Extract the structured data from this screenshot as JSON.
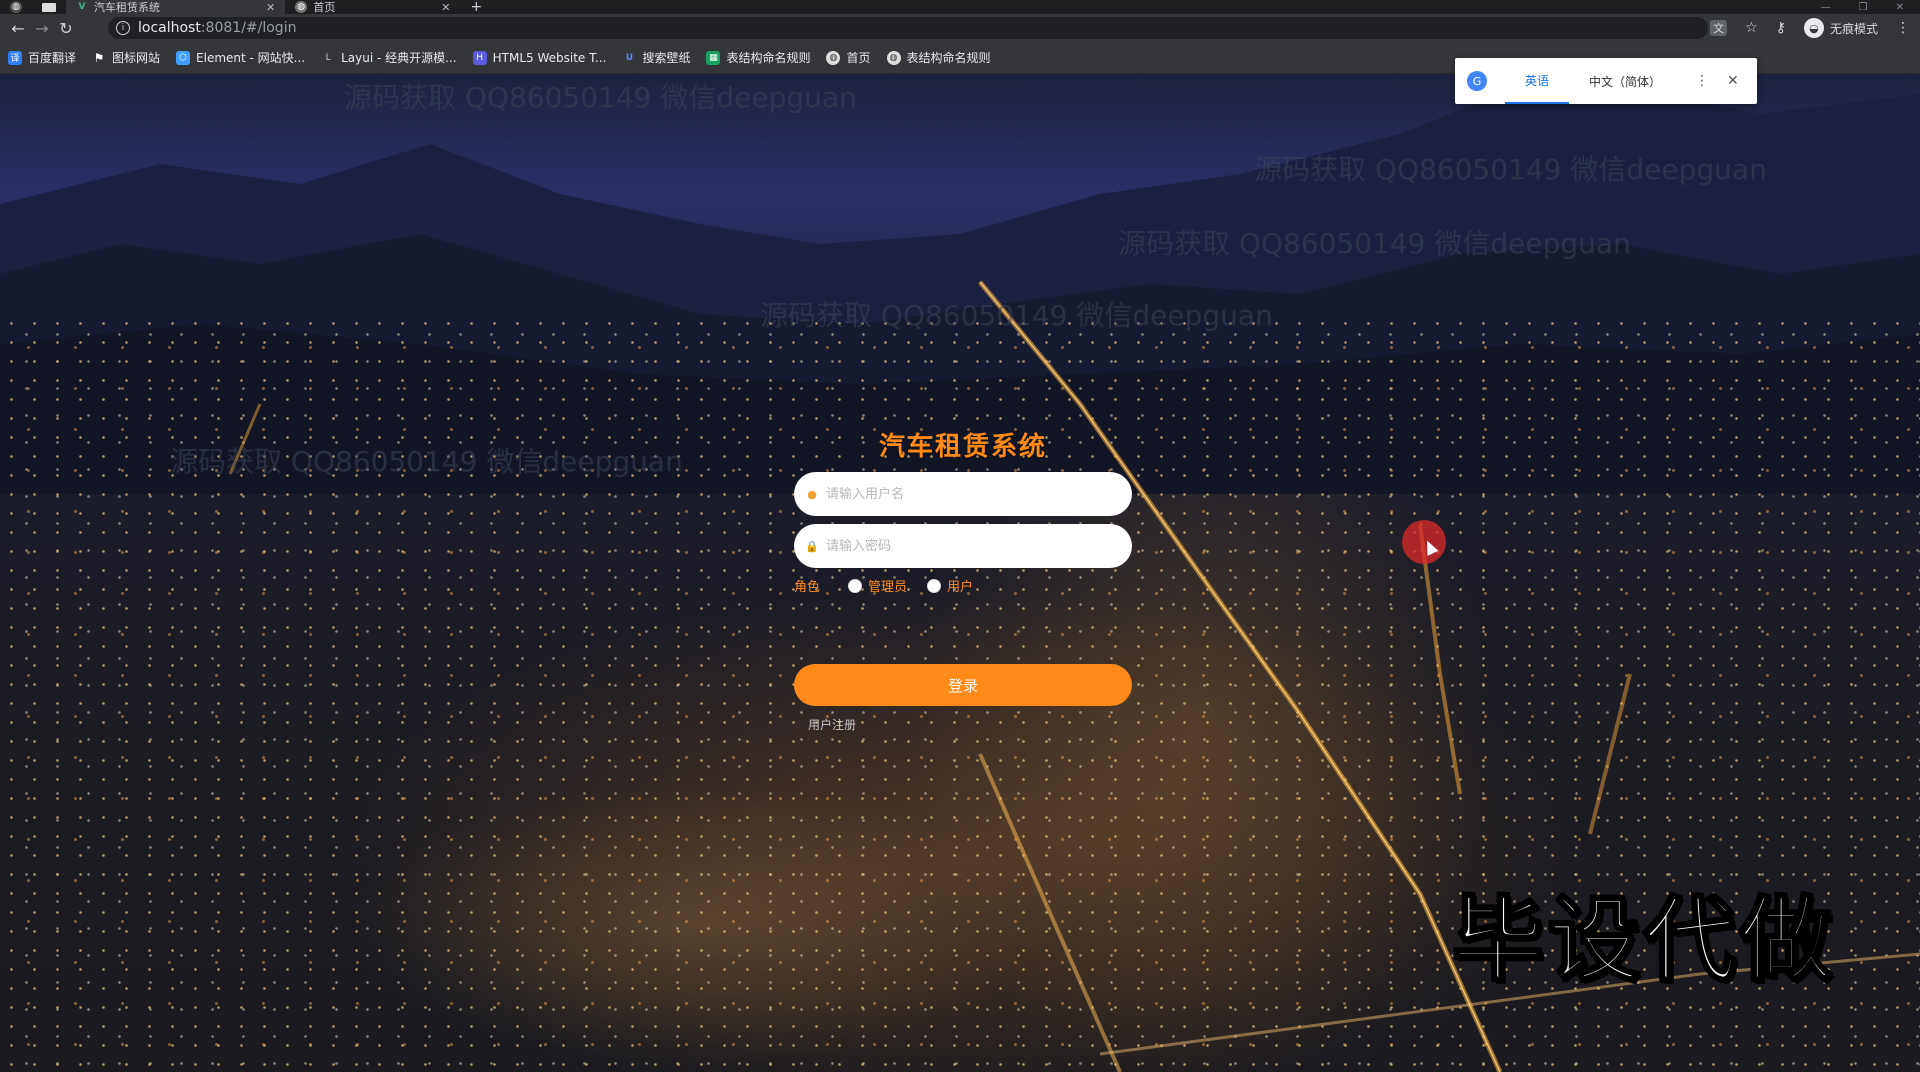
{
  "browser": {
    "tabs": [
      {
        "title": "汽车租赁系统",
        "active": true
      },
      {
        "title": "首页",
        "active": false
      }
    ],
    "new_tab": "+",
    "url_host": "localhost",
    "url_path": ":8081/#/login",
    "incognito_label": "无痕模式",
    "bookmarks": [
      {
        "label": "百度翻译",
        "color": "#2f7ff8",
        "glyph": "译"
      },
      {
        "label": "图标网站",
        "color": "#222222",
        "glyph": "⚑"
      },
      {
        "label": "Element - 网站快...",
        "color": "#409eff",
        "glyph": "⬡"
      },
      {
        "label": "Layui - 经典开源模...",
        "color": "#2f363c",
        "glyph": "L"
      },
      {
        "label": "HTML5 Website T...",
        "color": "#5a5ae0",
        "glyph": "H"
      },
      {
        "label": "搜索壁纸",
        "color": "#3a6ad6",
        "glyph": "U"
      },
      {
        "label": "表结构命名规则",
        "color": "#1aa260",
        "glyph": "▦"
      },
      {
        "label": "首页",
        "color": "#555555",
        "glyph": "◍"
      },
      {
        "label": "表结构命名规则",
        "color": "#555555",
        "glyph": "◍"
      }
    ],
    "translate": {
      "options": [
        "英语",
        "中文（简体）"
      ],
      "selected": 0
    }
  },
  "login": {
    "title": "汽车租赁系统",
    "username_placeholder": "请输入用户名",
    "password_placeholder": "请输入密码",
    "role_label": "角色",
    "roles": [
      "管理员",
      "用户"
    ],
    "submit_label": "登录",
    "register_link": "用户注册"
  },
  "overlay": {
    "watermark": "源码获取 QQ86050149 微信deepguan",
    "promo": "毕设代做"
  },
  "colors": {
    "accent": "#ff8a1a",
    "chrome": "#35363a"
  }
}
